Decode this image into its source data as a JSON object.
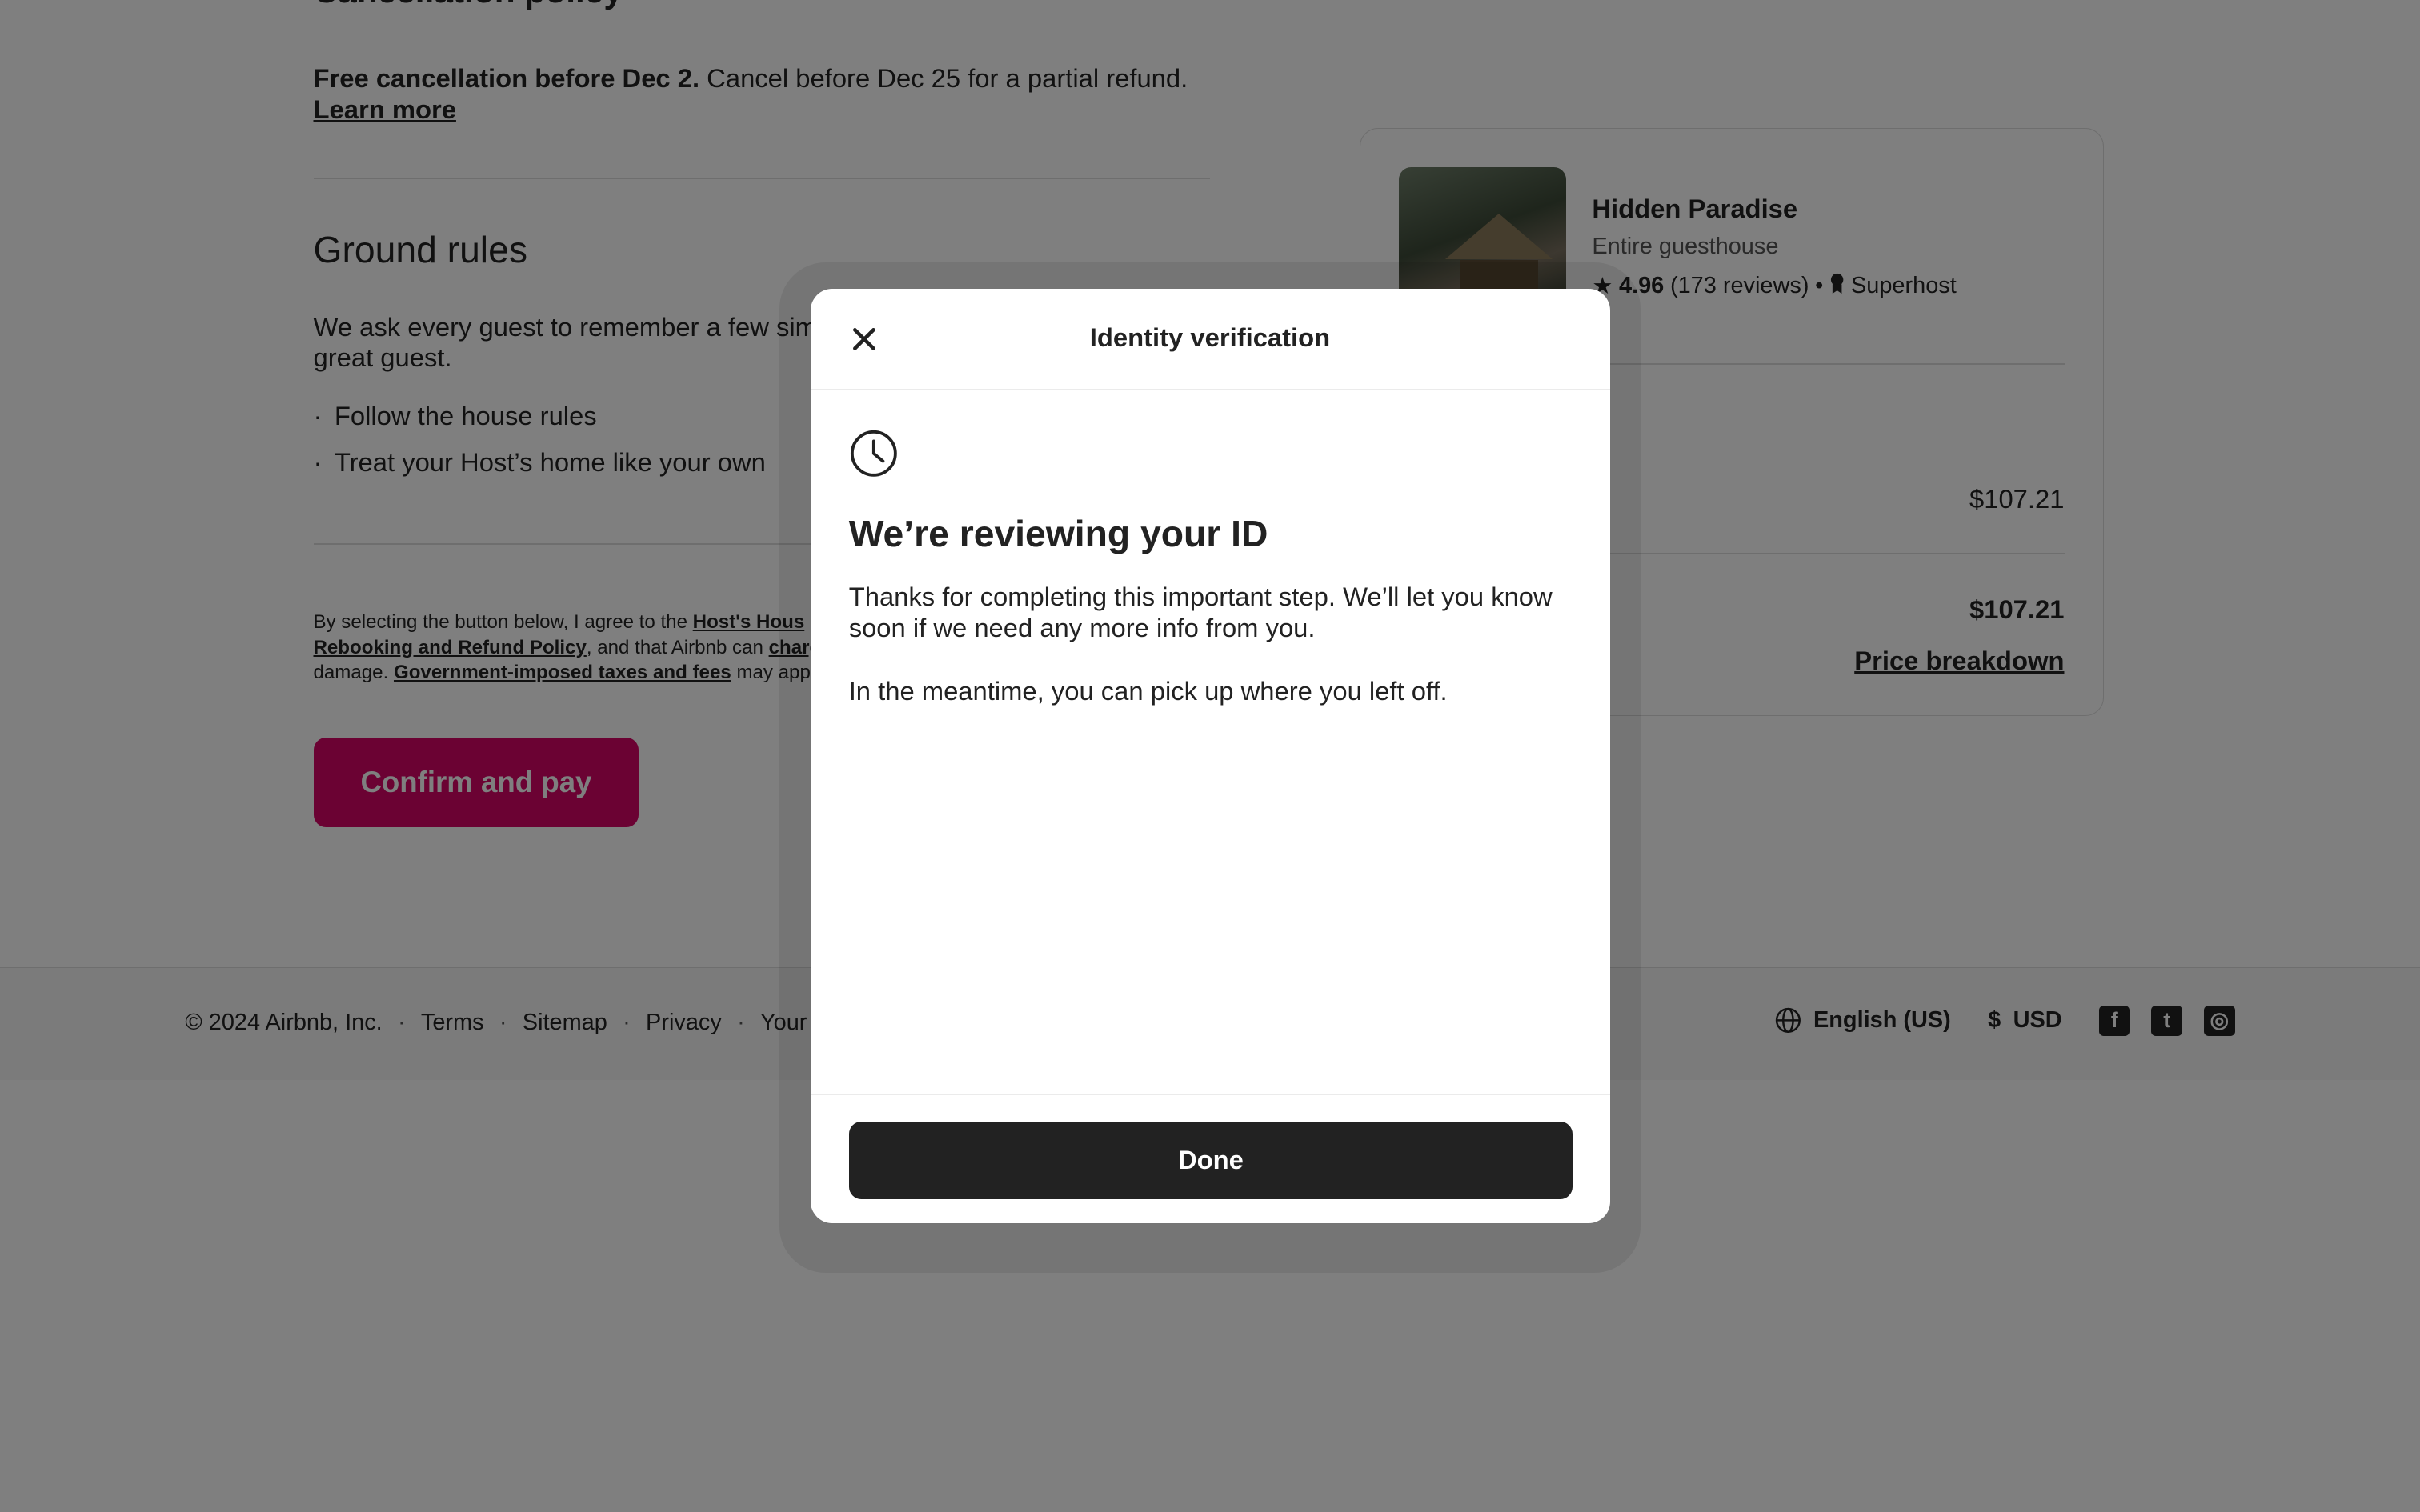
{
  "cancellation": {
    "title": "Cancellation policy",
    "bold": "Free cancellation before Dec 2.",
    "rest": " Cancel before Dec 25 for a partial refund.",
    "learn_more": "Learn more"
  },
  "ground_rules": {
    "title": "Ground rules",
    "intro_visible": "We ask every guest to remember a few sim",
    "intro_line2": "great guest.",
    "rules": [
      "Follow the house rules",
      "Treat your Host’s home like your own"
    ]
  },
  "legal": {
    "line1_prefix": "By selecting the button below, I agree to the ",
    "line1_link": "Host's Hous",
    "line2_link": "Rebooking and Refund Policy",
    "line2_mid": ", and that Airbnb can ",
    "line2_link2": "charg",
    "line3_prefix": "damage. ",
    "line3_link": "Government-imposed taxes and fees",
    "line3_suffix": " may app"
  },
  "confirm_button": "Confirm and pay",
  "listing": {
    "name": "Hidden Paradise",
    "type": "Entire guesthouse",
    "rating": "4.96",
    "reviews": "(173 reviews)",
    "bullet": "•",
    "badge": "Superhost",
    "price_line": "$107.21",
    "total": "$107.21",
    "breakdown_link": "Price breakdown"
  },
  "footer": {
    "copyright": "© 2024 Airbnb, Inc.",
    "links": [
      "Terms",
      "Sitemap",
      "Privacy",
      "Your Pri"
    ],
    "separator": "·",
    "language": "English (US)",
    "currency_symbol": "$",
    "currency": "USD",
    "social": [
      "facebook-icon",
      "twitter-icon",
      "instagram-icon"
    ]
  },
  "modal": {
    "title": "Identity verification",
    "heading": "We’re reviewing your ID",
    "paragraph1": "Thanks for completing this important step. We’ll let you know soon if we need any more info from you.",
    "paragraph2": "In the meantime, you can pick up where you left off.",
    "done_button": "Done",
    "icons": [
      "close-icon",
      "clock-icon"
    ]
  },
  "colors": {
    "brand": "#d70466",
    "done_button": "#222222",
    "overlay": "rgba(0,0,0,0.5)"
  }
}
